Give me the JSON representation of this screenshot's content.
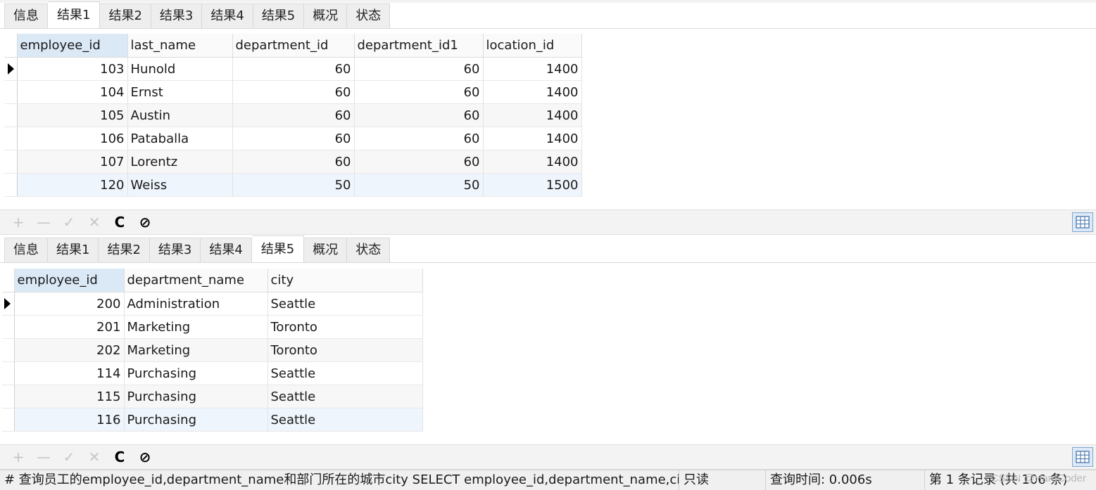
{
  "panel1": {
    "tabs": [
      "信息",
      "结果1",
      "结果2",
      "结果3",
      "结果4",
      "结果5",
      "概况",
      "状态"
    ],
    "active_tab": 1,
    "columns": [
      "employee_id",
      "last_name",
      "department_id",
      "department_id1",
      "location_id"
    ],
    "rows": [
      [
        "103",
        "Hunold",
        "60",
        "60",
        "1400"
      ],
      [
        "104",
        "Ernst",
        "60",
        "60",
        "1400"
      ],
      [
        "105",
        "Austin",
        "60",
        "60",
        "1400"
      ],
      [
        "106",
        "Pataballa",
        "60",
        "60",
        "1400"
      ],
      [
        "107",
        "Lorentz",
        "60",
        "60",
        "1400"
      ],
      [
        "120",
        "Weiss",
        "50",
        "50",
        "1500"
      ]
    ]
  },
  "panel2": {
    "tabs": [
      "信息",
      "结果1",
      "结果2",
      "结果3",
      "结果4",
      "结果5",
      "概况",
      "状态"
    ],
    "active_tab": 5,
    "columns": [
      "employee_id",
      "department_name",
      "city"
    ],
    "rows": [
      [
        "200",
        "Administration",
        "Seattle"
      ],
      [
        "201",
        "Marketing",
        "Toronto"
      ],
      [
        "202",
        "Marketing",
        "Toronto"
      ],
      [
        "114",
        "Purchasing",
        "Seattle"
      ],
      [
        "115",
        "Purchasing",
        "Seattle"
      ],
      [
        "116",
        "Purchasing",
        "Seattle"
      ]
    ]
  },
  "toolbar": {
    "add": "+",
    "remove": "—",
    "apply": "✓",
    "discard": "✕",
    "refresh": "C",
    "stop": "⊘"
  },
  "status": {
    "query": "# 查询员工的employee_id,department_name和部门所在的城市city SELECT employee_id,department_name,city FI",
    "mode": "只读",
    "time": "查询时间: 0.006s",
    "records": "第 1 条记录 (共 106 条)"
  },
  "watermark": "CSDN @HardCoder"
}
